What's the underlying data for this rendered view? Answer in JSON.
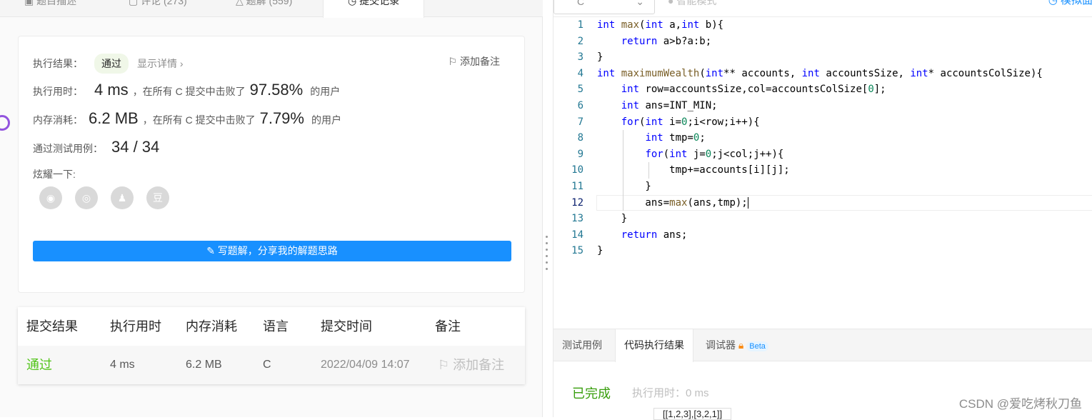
{
  "left_tabs": [
    "题目描述",
    "评论 (273)",
    "题解 (559)",
    "提交记录"
  ],
  "result": {
    "label": "执行结果：",
    "status": "通过",
    "detail": "显示详情 ›",
    "add_note": "添加备注",
    "time_label": "执行用时：",
    "time_value": "4 ms",
    "time_text": "，在所有 C 提交中击败了",
    "time_pct": "97.58%",
    "users": "的用户",
    "mem_label": "内存消耗：",
    "mem_value": "6.2 MB",
    "mem_text": "，在所有 C 提交中击败了",
    "mem_pct": "7.79%",
    "cases_label": "通过测试用例：",
    "cases_value": "34 / 34",
    "share_label": "炫耀一下:",
    "share_icons": [
      "wechat-icon",
      "weibo-icon",
      "qq-icon",
      "douban-icon"
    ],
    "douban_char": "豆",
    "write_btn": "写题解，分享我的解题思路"
  },
  "table": {
    "headers": [
      "提交结果",
      "执行用时",
      "内存消耗",
      "语言",
      "提交时间",
      "备注"
    ],
    "row": {
      "result": "通过",
      "time": "4 ms",
      "mem": "6.2 MB",
      "lang": "C",
      "submitted": "2022/04/09 14:07",
      "note": "添加备注"
    }
  },
  "editor": {
    "language": "C",
    "smart_mode": "智能模式",
    "mock": "模拟面",
    "lines": [
      "int max(int a,int b){",
      "    return a>b?a:b;",
      "}",
      "int maximumWealth(int** accounts, int accountsSize, int* accountsColSize){",
      "    int row=accountsSize,col=accountsColSize[0];",
      "    int ans=INT_MIN;",
      "    for(int i=0;i<row;i++){",
      "        int tmp=0;",
      "        for(int j=0;j<col;j++){",
      "            tmp+=accounts[i][j];",
      "        }",
      "        ans=max(ans,tmp);",
      "    }",
      "    return ans;",
      "}"
    ],
    "current_line": 12
  },
  "bottom": {
    "tabs": [
      "测试用例",
      "代码执行结果",
      "调试器"
    ],
    "beta": "Beta",
    "status": "已完成",
    "exec_time": "执行用时：0 ms",
    "input": "[[1,2,3],[3,2,1]]"
  },
  "watermark": "CSDN @爱吃烤秋刀鱼",
  "colors": {
    "accent": "#1890ff",
    "success": "#389e0d"
  }
}
